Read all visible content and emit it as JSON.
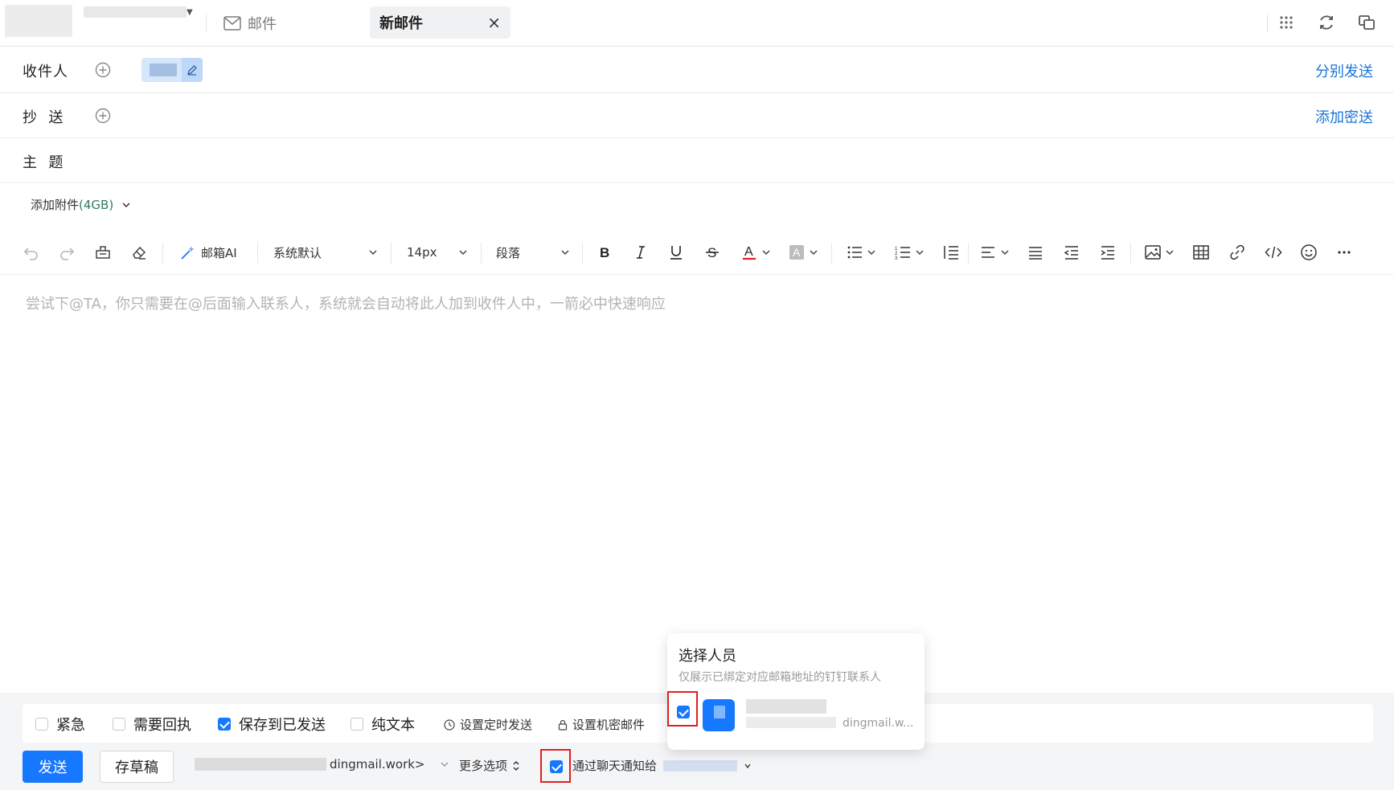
{
  "topbar": {
    "mail_tab_label": "邮件",
    "new_tab_label": "新邮件",
    "close_symbol": "×",
    "icons": [
      "apps-grid-icon",
      "refresh-icon",
      "switch-window-icon"
    ]
  },
  "compose": {
    "to_label": "收件人",
    "cc_label": "抄  送",
    "subject_label": "主  题",
    "send_separately_link": "分别发送",
    "add_bcc_link": "添加密送",
    "attach_label": "添加附件",
    "attach_size": "(4GB)"
  },
  "toolbar": {
    "ai_label": "邮箱AI",
    "font_family": "系统默认",
    "font_size": "14px",
    "paragraph": "段落"
  },
  "editor": {
    "placeholder": "尝试下@TA，你只需要在@后面输入联系人，系统就会自动将此人加到收件人中，一箭必中快速响应"
  },
  "options": {
    "urgent": "紧急",
    "receipt": "需要回执",
    "save_sent": "保存到已发送",
    "plain_text": "纯文本",
    "schedule": "设置定时发送",
    "confidential": "设置机密邮件"
  },
  "footer": {
    "send_label": "发送",
    "draft_label": "存草稿",
    "from_suffix": "dingmail.work>",
    "more_options": "更多选项",
    "notify_label": "通过聊天通知给"
  },
  "popover": {
    "title": "选择人员",
    "subtitle": "仅展示已绑定对应邮箱地址的钉钉联系人",
    "email_suffix": "dingmail.w..."
  },
  "colors": {
    "accent": "#1677ff",
    "link": "#1a73d9",
    "highlight_box": "#e02020"
  }
}
